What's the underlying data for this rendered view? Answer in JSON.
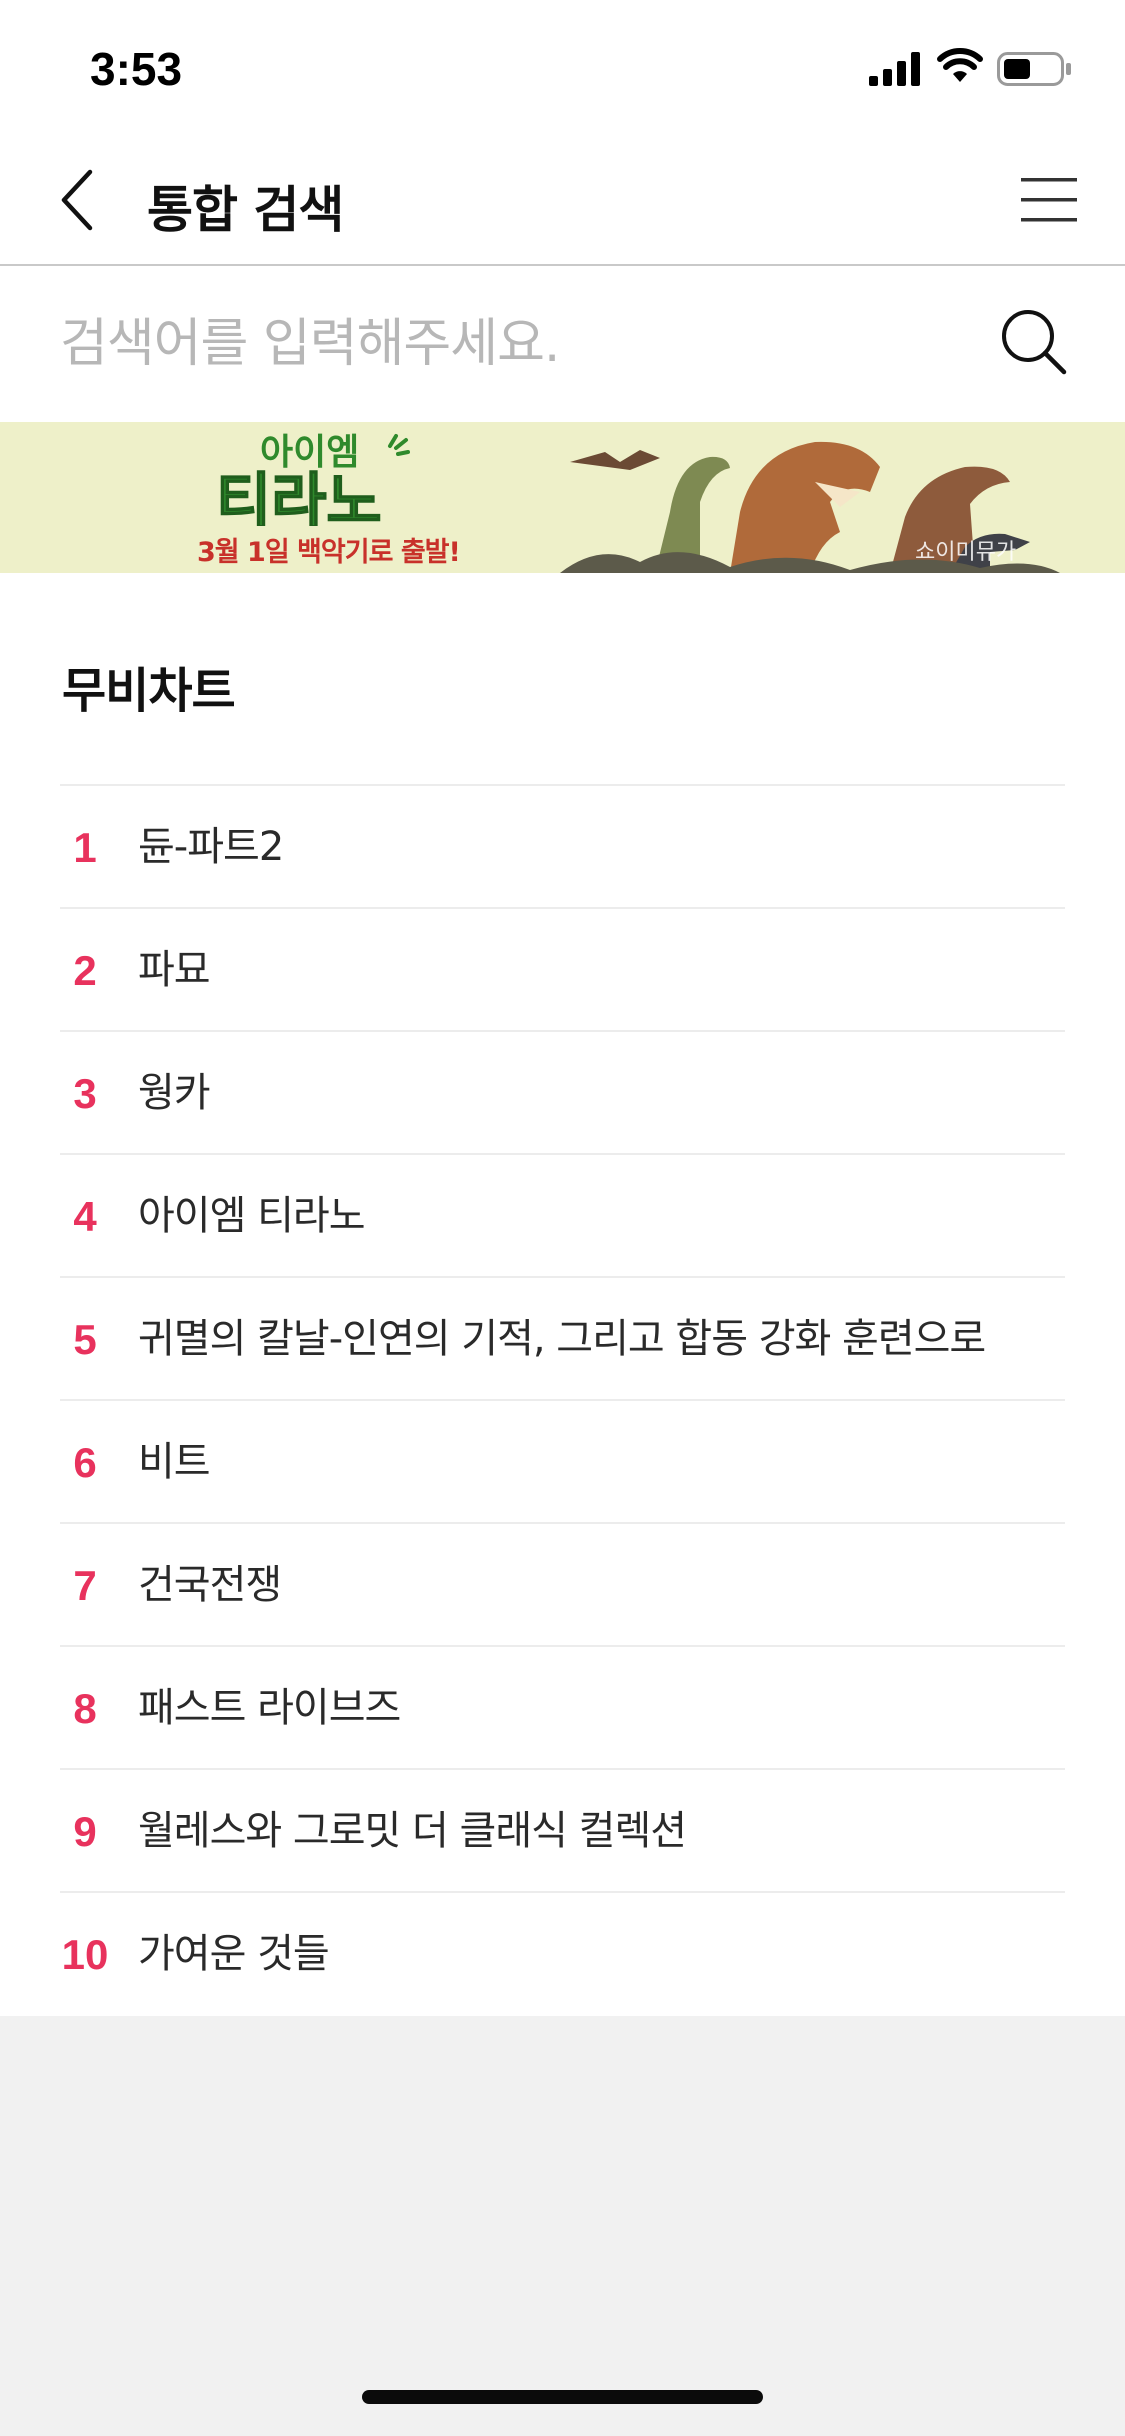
{
  "status_bar": {
    "time": "3:53",
    "icons": [
      "cellular-signal-icon",
      "wifi-icon",
      "battery-icon"
    ]
  },
  "header": {
    "title": "통합 검색",
    "back_icon": "chevron-left-icon",
    "menu_icon": "hamburger-menu-icon"
  },
  "search": {
    "placeholder": "검색어를 입력해주세요.",
    "value": "",
    "icon": "search-icon"
  },
  "banner": {
    "logo_line1": "아이엠",
    "logo_line2": "티라노",
    "tagline": "3월 1일 백악기로 출발!",
    "watermark": "쇼이미뮤가",
    "background_color": "#eef0c9"
  },
  "movie_chart": {
    "title": "무비차트",
    "rank_color": "#e8325d",
    "items": [
      {
        "rank": "1",
        "title": "듄-파트2"
      },
      {
        "rank": "2",
        "title": "파묘"
      },
      {
        "rank": "3",
        "title": "웡카"
      },
      {
        "rank": "4",
        "title": "아이엠 티라노"
      },
      {
        "rank": "5",
        "title": "귀멸의 칼날-인연의 기적, 그리고 합동 강화 훈련으로"
      },
      {
        "rank": "6",
        "title": "비트"
      },
      {
        "rank": "7",
        "title": "건국전쟁"
      },
      {
        "rank": "8",
        "title": "패스트 라이브즈"
      },
      {
        "rank": "9",
        "title": "월레스와 그로밋 더 클래식 컬렉션"
      },
      {
        "rank": "10",
        "title": "가여운 것들"
      }
    ]
  }
}
